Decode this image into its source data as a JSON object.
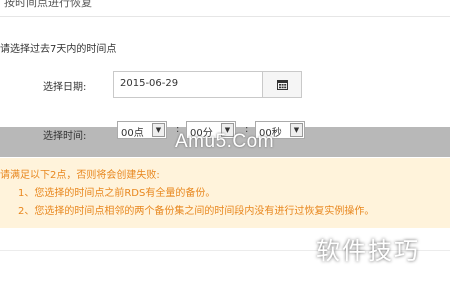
{
  "header": {
    "partial_title": "按时间点进行恢复"
  },
  "form": {
    "prompt": "请选择过去7天内的时间点",
    "date_label": "选择日期:",
    "date_value": "2015-06-29",
    "time_label": "选择时间:",
    "hour_value": "00点",
    "minute_value": "00分",
    "second_value": "00秒"
  },
  "warning": {
    "title": "请满足以下2点，否则将会创建失败:",
    "items": [
      "1、您选择的时间点之前RDS有全量的备份。",
      "2、您选择的时间点相邻的两个备份集之间的时间段内没有进行过恢复实例操作。"
    ]
  },
  "watermarks": {
    "site": "Amu5.Com",
    "brand": "软件技巧"
  },
  "colors": {
    "warning_text": "#e8871e",
    "warning_bg": "#fff3db"
  }
}
